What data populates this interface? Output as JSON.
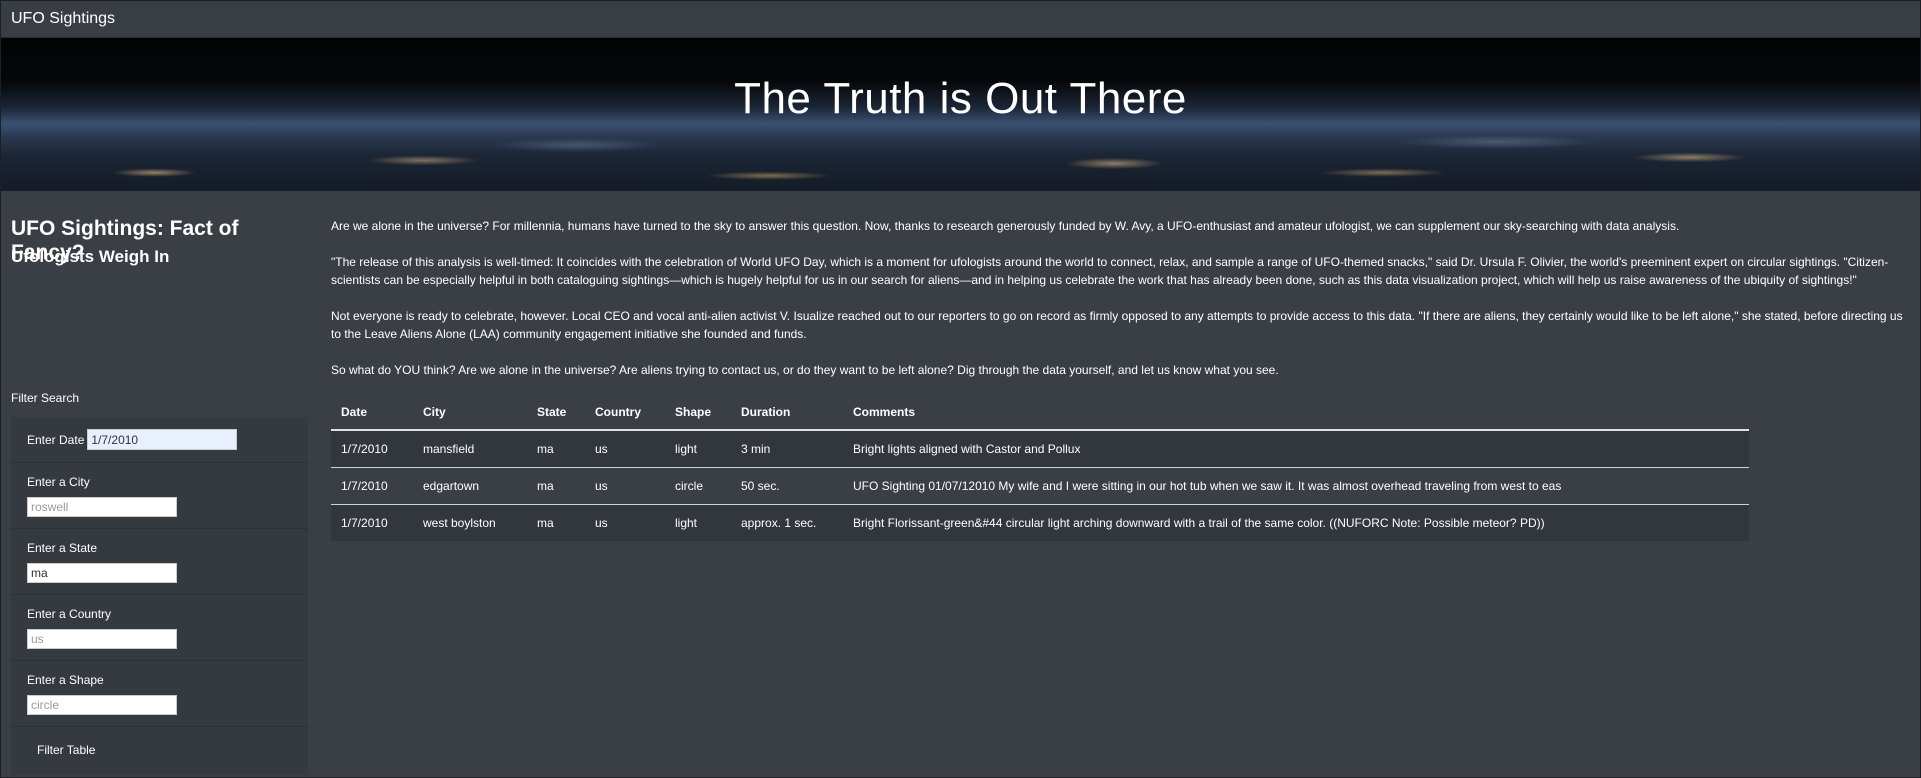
{
  "navbar": {
    "brand": "UFO Sightings"
  },
  "hero": {
    "title": "The Truth is Out There"
  },
  "sidebar": {
    "headline": "UFO Sightings: Fact of Fancy?",
    "subhead": "Ufologists Weigh In",
    "filter_title": "Filter Search",
    "filters": {
      "date": {
        "label": "Enter Date",
        "value": "1/7/2010",
        "placeholder": ""
      },
      "city": {
        "label": "Enter a City",
        "value": "",
        "placeholder": "roswell"
      },
      "state": {
        "label": "Enter a State",
        "value": "ma",
        "placeholder": ""
      },
      "country": {
        "label": "Enter a Country",
        "value": "",
        "placeholder": "us"
      },
      "shape": {
        "label": "Enter a Shape",
        "value": "",
        "placeholder": "circle"
      }
    },
    "filter_button": "Filter Table"
  },
  "article": {
    "p1": "Are we alone in the universe? For millennia, humans have turned to the sky to answer this question. Now, thanks to research generously funded by W. Avy, a UFO-enthusiast and amateur ufologist, we can supplement our sky-searching with data analysis.",
    "p2": "\"The release of this analysis is well-timed: It coincides with the celebration of World UFO Day, which is a moment for ufologists around the world to connect, relax, and sample a range of UFO-themed snacks,\" said Dr. Ursula F. Olivier, the world's preeminent expert on circular sightings. \"Citizen-scientists can be especially helpful in both cataloguing sightings—which is hugely helpful for us in our search for aliens—and in helping us celebrate the work that has already been done, such as this data visualization project, which will help us raise awareness of the ubiquity of sightings!\"",
    "p3": "Not everyone is ready to celebrate, however. Local CEO and vocal anti-alien activist V. Isualize reached out to our reporters to go on record as firmly opposed to any attempts to provide access to this data. \"If there are aliens, they certainly would like to be left alone,\" she stated, before directing us to the Leave Aliens Alone (LAA) community engagement initiative she founded and funds.",
    "p4": "So what do YOU think? Are we alone in the universe? Are aliens trying to contact us, or do they want to be left alone? Dig through the data yourself, and let us know what you see."
  },
  "table": {
    "headers": [
      "Date",
      "City",
      "State",
      "Country",
      "Shape",
      "Duration",
      "Comments"
    ],
    "rows": [
      [
        "1/7/2010",
        "mansfield",
        "ma",
        "us",
        "light",
        "3 min",
        "Bright lights aligned with Castor and Pollux"
      ],
      [
        "1/7/2010",
        "edgartown",
        "ma",
        "us",
        "circle",
        "50 sec.",
        "UFO Sighting 01/07/12010 My wife and I were sitting in our hot tub when we saw it. It was almost overhead traveling from west to eas"
      ],
      [
        "1/7/2010",
        "west boylston",
        "ma",
        "us",
        "light",
        "approx. 1 sec.",
        "Bright Florissant-green&#44 circular light arching downward with a trail of the same color. ((NUFORC Note: Possible meteor? PD))"
      ]
    ]
  }
}
